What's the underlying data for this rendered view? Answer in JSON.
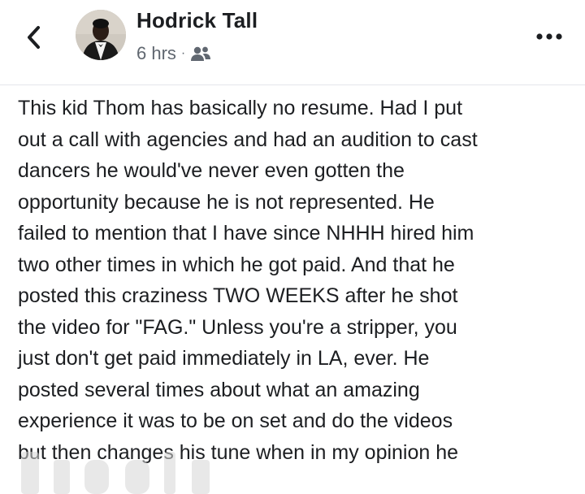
{
  "post": {
    "author_name": "Hodrick Tall",
    "timestamp": "6 hrs",
    "separator": "·",
    "audience_icon": "friends-icon",
    "text_lines": [
      "This kid Thom has basically no resume. Had I put",
      "out a call with agencies and had an audition to cast",
      "dancers he would've never even gotten the",
      "opportunity because he is not represented. He",
      "failed to mention that I have since NHHH hired him",
      "two other times in which he got paid. And that he",
      "posted this craziness TWO WEEKS after he shot",
      "the video for \"FAG.\" Unless you're a stripper, you",
      "just don't get paid immediately in LA, ever. He",
      "posted several times about what an amazing",
      "experience it was to be on set and do the videos",
      "but then changes his tune when in my opinion he"
    ]
  },
  "icons": {
    "back": "chevron-left-icon",
    "more": "more-horizontal-icon"
  },
  "colors": {
    "name": "#1c1e21",
    "meta": "#606770",
    "body_text": "#1c1e21",
    "divider": "#e4e6eb"
  }
}
